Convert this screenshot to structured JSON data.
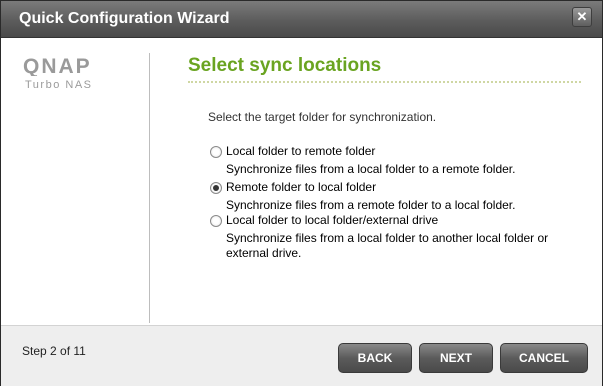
{
  "window": {
    "title": "Quick Configuration Wizard",
    "close_glyph": "✕"
  },
  "brand": {
    "logo_text": "QNAP",
    "subtitle": "Turbo NAS"
  },
  "page": {
    "heading": "Select sync locations",
    "instruction": "Select the target folder for synchronization."
  },
  "options": [
    {
      "label": "Local folder to remote folder",
      "description": "Synchronize files from a local folder to a remote folder.",
      "selected": false
    },
    {
      "label": "Remote folder to local folder",
      "description": "Synchronize files from a remote folder to a local folder.",
      "selected": true
    },
    {
      "label": "Local folder to local folder/external drive",
      "description": "Synchronize files from a local folder to another local folder or external drive.",
      "selected": false
    }
  ],
  "footer": {
    "step_text": "Step 2 of 11",
    "back_label": "BACK",
    "next_label": "NEXT",
    "cancel_label": "CANCEL"
  },
  "colors": {
    "heading": "#6aa421",
    "titlebar": "#5c5c5c"
  }
}
